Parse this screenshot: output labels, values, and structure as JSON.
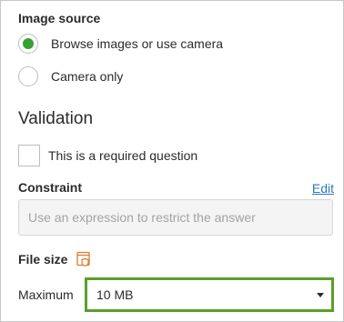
{
  "image_source": {
    "label": "Image source",
    "options": [
      {
        "label": "Browse images or use camera",
        "selected": true
      },
      {
        "label": "Camera only",
        "selected": false
      }
    ]
  },
  "validation": {
    "heading": "Validation",
    "required_label": "This is a required question",
    "required_checked": false
  },
  "constraint": {
    "label": "Constraint",
    "edit_link": "Edit",
    "placeholder": "Use an expression to restrict the answer",
    "value": ""
  },
  "file_size": {
    "label": "File size",
    "icon": "file-shield-icon",
    "maximum_label": "Maximum",
    "maximum_value": "10 MB"
  },
  "colors": {
    "radio_selected": "#35a12e",
    "link": "#2f7ab9",
    "highlight_border": "#5a9f2a",
    "icon_orange": "#e07b2c"
  }
}
